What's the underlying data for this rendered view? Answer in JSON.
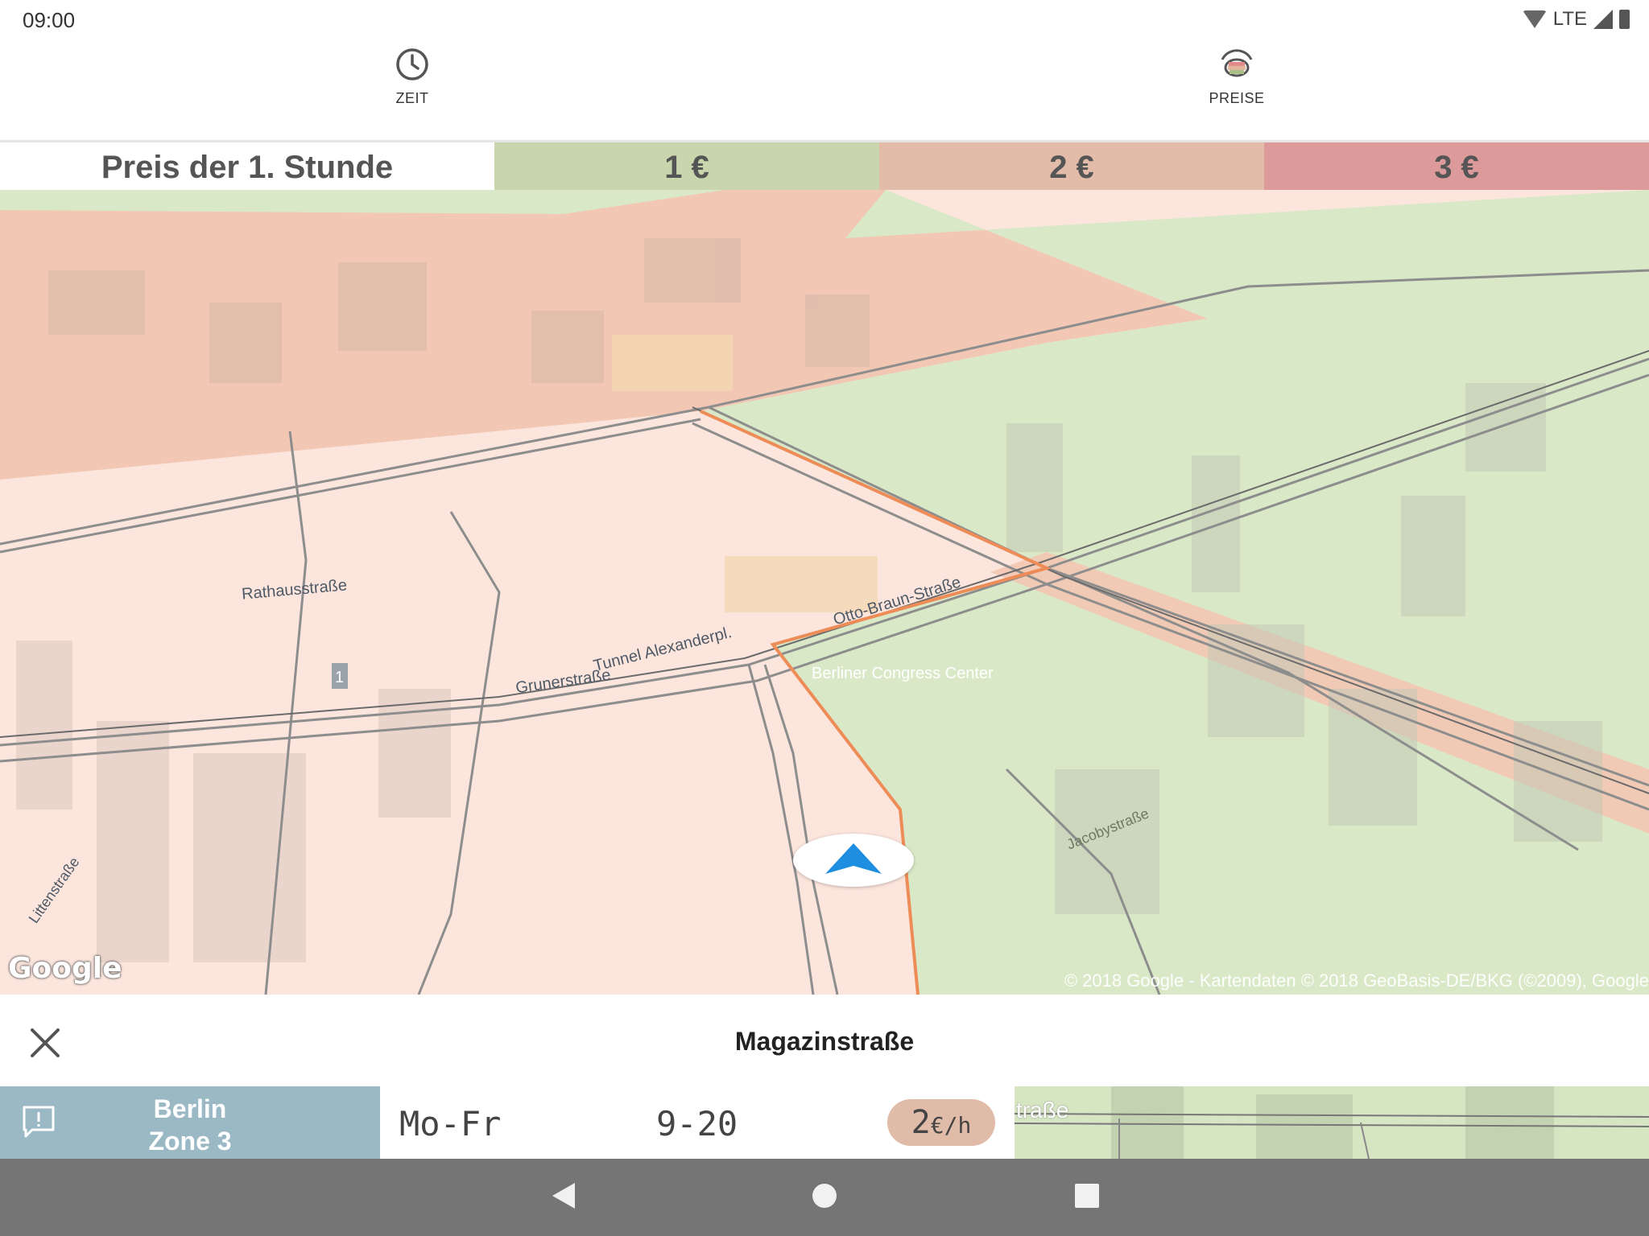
{
  "status": {
    "time": "09:00",
    "network": "LTE"
  },
  "tabs": [
    {
      "label": "ZEIT",
      "icon": "clock-icon"
    },
    {
      "label": "PREISE",
      "icon": "price-signal-icon"
    }
  ],
  "legend": {
    "title": "Preis der 1. Stunde",
    "tiers": [
      {
        "label": "1 €",
        "color": "#c9d6ad"
      },
      {
        "label": "2 €",
        "color": "#e2bba9"
      },
      {
        "label": "3 €",
        "color": "#dc9a9a"
      }
    ]
  },
  "map": {
    "street_labels": [
      "Rathausstraße",
      "Tunnel Alexanderpl.",
      "Grunerstraße",
      "Otto-Braun-Straße",
      "Berliner Congress Center",
      "Littenstraße",
      "Jacobystraße"
    ],
    "route_shield": "1",
    "google_logo": "Google",
    "attribution": "© 2018 Google - Kartendaten © 2018 GeoBasis-DE/BKG (©2009), Google"
  },
  "sheet": {
    "title": "Magazinstraße",
    "zone": {
      "line1": "Berlin",
      "line2": "Zone 3"
    },
    "days": "Mo-Fr",
    "hours": "9-20",
    "price_value": "2",
    "price_unit": "€/h",
    "mini_map_label": "traße"
  }
}
